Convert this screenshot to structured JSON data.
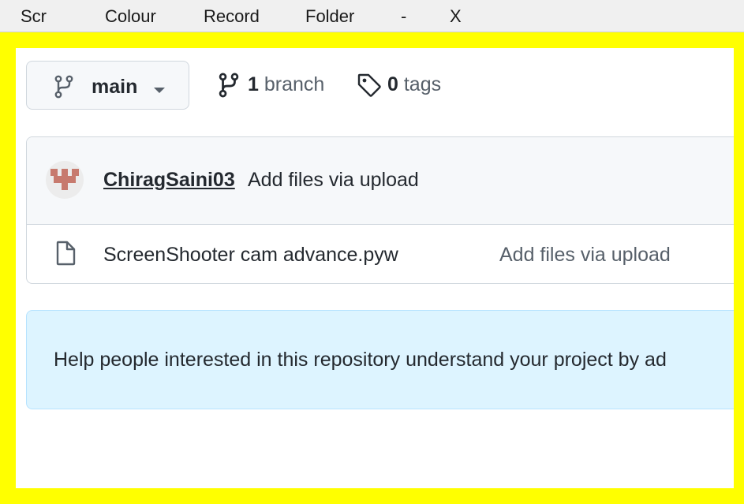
{
  "menu": {
    "scr": "Scr",
    "colour": "Colour",
    "record": "Record",
    "folder": "Folder",
    "minimize": "-",
    "close": "X"
  },
  "colors": {
    "frame": "#ffff00",
    "accent_link": "#24292f",
    "help_bg": "#ddf4ff"
  },
  "repo": {
    "branch_button": {
      "label": "main",
      "icon": "git-branch-icon"
    },
    "branches": {
      "count": "1",
      "label": "branch",
      "icon": "git-branch-icon"
    },
    "tags": {
      "count": "0",
      "label": "tags",
      "icon": "tag-icon"
    }
  },
  "commit": {
    "author": "ChiragSaini03",
    "message": "Add files via upload",
    "avatar_icon": "identicon-avatar"
  },
  "files": [
    {
      "name": "ScreenShooter cam advance.pyw",
      "commit": "Add files via upload",
      "icon": "file-icon"
    }
  ],
  "readme_hint": {
    "text": "Help people interested in this repository understand your project by ad"
  }
}
